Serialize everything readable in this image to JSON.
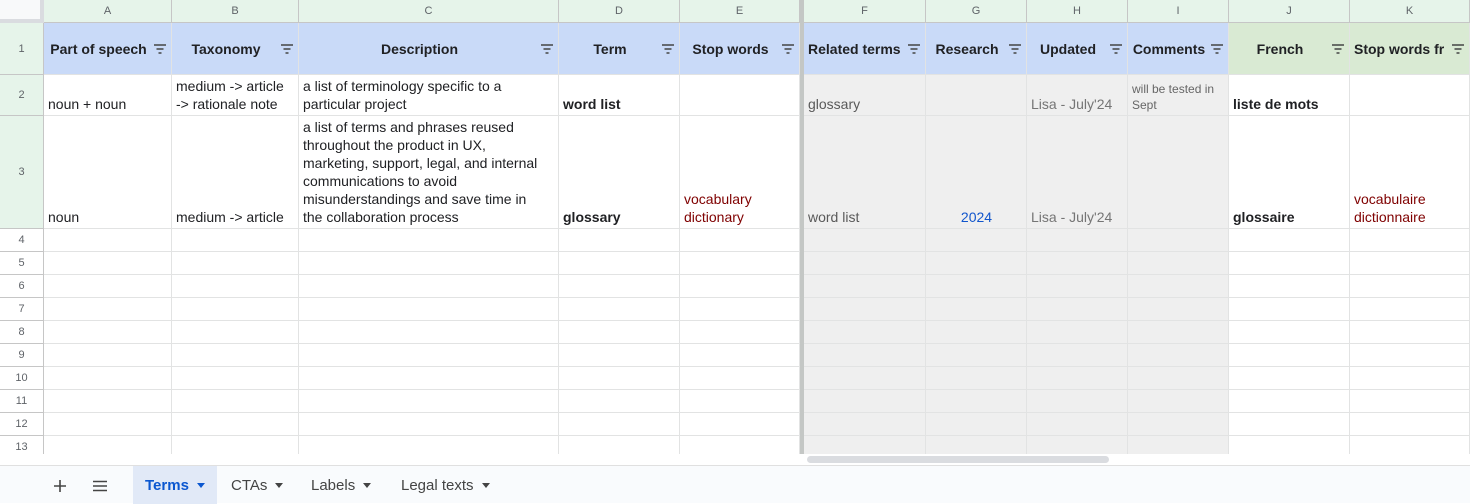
{
  "columns": [
    "A",
    "B",
    "C",
    "D",
    "E",
    "F",
    "G",
    "H",
    "I",
    "J",
    "K"
  ],
  "rows": [
    "1",
    "2",
    "3",
    "4",
    "5",
    "6",
    "7",
    "8",
    "9",
    "10",
    "11",
    "12",
    "13"
  ],
  "headers": {
    "A": "Part of speech",
    "B": "Taxonomy",
    "C": "Description",
    "D": "Term",
    "E": "Stop words",
    "F": "Related terms",
    "G": "Research",
    "H": "Updated",
    "I": "Comments",
    "J": "French",
    "K": "Stop words fr"
  },
  "row2": {
    "A": "noun + noun",
    "B": "medium -> article\n-> rationale note",
    "C": "a list of terminology specific to a\nparticular project",
    "D": "word list",
    "E": "",
    "F": "glossary",
    "G": "",
    "H": "Lisa - July'24",
    "I": "will be tested in\nSept",
    "J": "liste de mots",
    "K": ""
  },
  "row3": {
    "A": "noun",
    "B": "medium -> article",
    "C": "a list of terms and phrases reused\nthroughout the product in UX,\nmarketing, support, legal, and internal\ncommunications to avoid\nmisunderstandings and save time in\nthe collaboration process",
    "D": "glossary",
    "E": "vocabulary\ndictionary",
    "F": "word list",
    "G": "2024",
    "H": "Lisa - July'24",
    "I": "",
    "J": "glossaire",
    "K": "vocabulaire\ndictionnaire"
  },
  "sheet_tabs": {
    "add_icon": "plus-icon",
    "menu_icon": "hamburger-icon",
    "tabs": [
      "Terms",
      "CTAs",
      "Labels",
      "Legal texts"
    ],
    "active": "Terms"
  }
}
